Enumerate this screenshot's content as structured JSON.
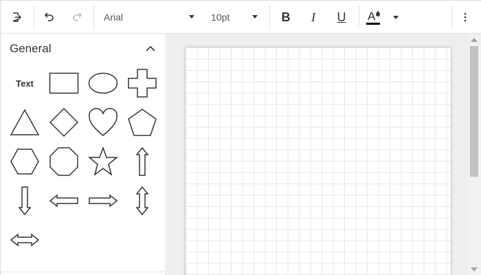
{
  "toolbar": {
    "font_family": "Arial",
    "font_size": "10pt",
    "bold_label": "B",
    "italic_label": "I",
    "underline_label": "U",
    "font_color_label": "A",
    "font_color_value": "#000000",
    "icons": [
      "export-icon",
      "undo-icon",
      "redo-icon",
      "font-color-icon",
      "more-vertical-icon"
    ]
  },
  "panel": {
    "title": "General",
    "shapes": [
      {
        "name": "text",
        "label": "Text"
      },
      {
        "name": "rectangle"
      },
      {
        "name": "ellipse"
      },
      {
        "name": "cross"
      },
      {
        "name": "triangle"
      },
      {
        "name": "diamond"
      },
      {
        "name": "heart"
      },
      {
        "name": "pentagon"
      },
      {
        "name": "hexagon"
      },
      {
        "name": "octagon"
      },
      {
        "name": "star"
      },
      {
        "name": "arrow-up"
      },
      {
        "name": "arrow-down"
      },
      {
        "name": "arrow-left"
      },
      {
        "name": "arrow-right"
      },
      {
        "name": "arrow-up-down"
      },
      {
        "name": "arrow-left-right"
      }
    ]
  },
  "colors": {
    "accent": "#000000",
    "canvas_background": "#eeeeee",
    "grid_line": "#e6e6e6"
  }
}
